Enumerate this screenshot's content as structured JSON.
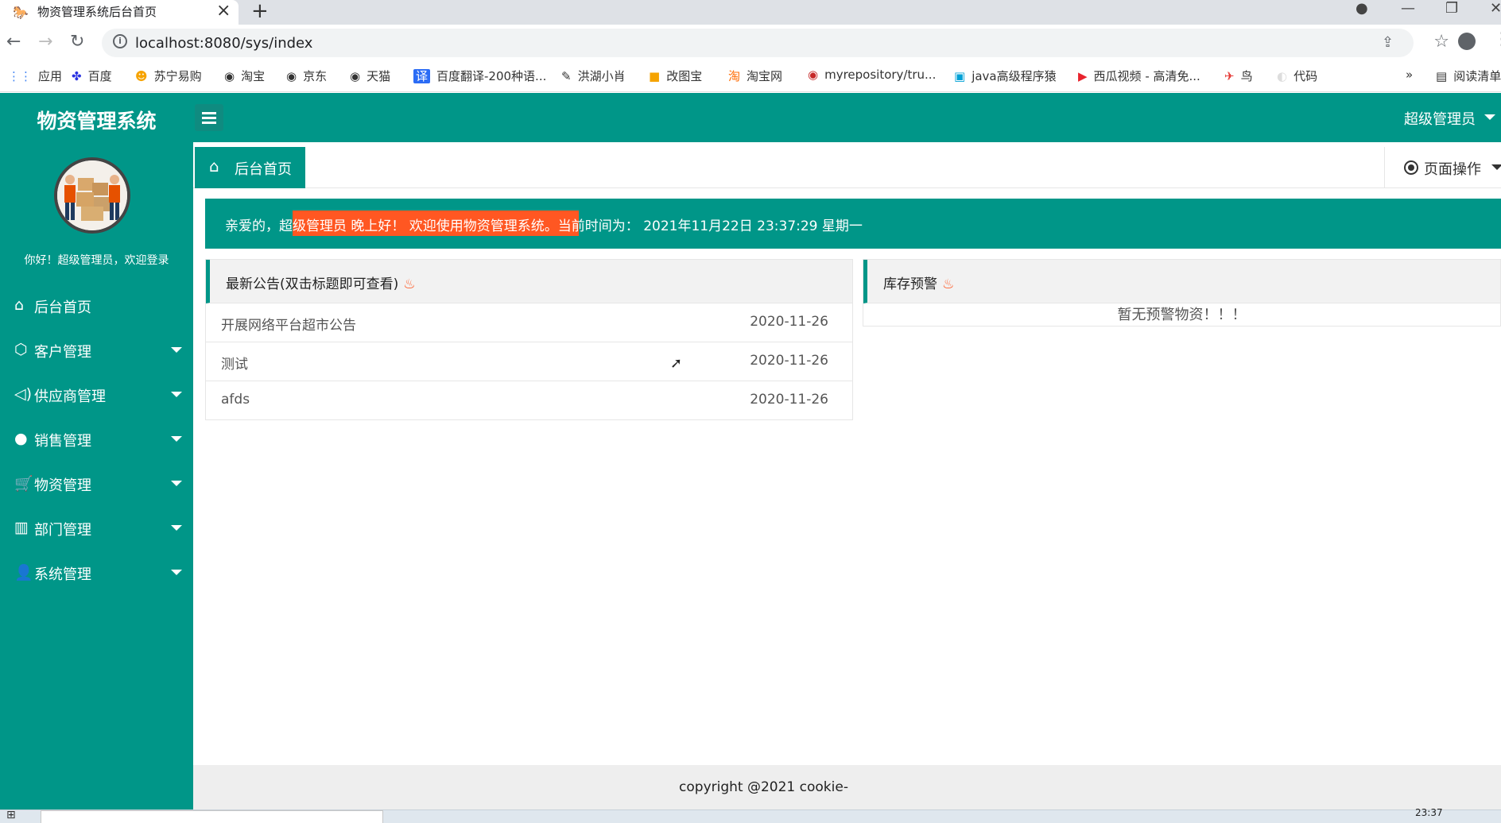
{
  "browser": {
    "tab_title": "物资管理系统后台首页",
    "url": "localhost:8080/sys/index",
    "bookmarks": [
      "应用",
      "百度",
      "苏宁易购",
      "淘宝",
      "京东",
      "天猫",
      "百度翻译-200种语...",
      "洪湖小肖",
      "改图宝",
      "淘宝网",
      "myrepository/tru...",
      "java高级程序猿",
      "西瓜视频 - 高清免...",
      "鸟",
      "代码"
    ],
    "reading_list": "阅读清单"
  },
  "app": {
    "logo": "物资管理系统",
    "greeting": "你好！超级管理员，欢迎登录",
    "user": "超级管理员",
    "menu": [
      {
        "label": "后台首页",
        "icon": "home-icon"
      },
      {
        "label": "客户管理",
        "icon": "cube-icon"
      },
      {
        "label": "供应商管理",
        "icon": "speaker-icon"
      },
      {
        "label": "销售管理",
        "icon": "chat-icon"
      },
      {
        "label": "物资管理",
        "icon": "cart-icon"
      },
      {
        "label": "部门管理",
        "icon": "building-icon"
      },
      {
        "label": "系统管理",
        "icon": "user-icon"
      }
    ],
    "home_tab": "后台首页",
    "page_ops": "页面操作",
    "welcome": "亲爱的，超级管理员 晚上好！  欢迎使用物资管理系统。当前时间为：  2021年11月22日 23:37:29    星期一",
    "notices_title": "最新公告(双击标题即可查看)",
    "notices": [
      {
        "title": "开展网络平台超市公告",
        "date": "2020-11-26"
      },
      {
        "title": "测试",
        "date": "2020-11-26"
      },
      {
        "title": "afds",
        "date": "2020-11-26"
      }
    ],
    "warning_title": "库存预警",
    "warning_empty": "暂无预警物资！！！",
    "footer": "copyright @2021 cookie-"
  },
  "taskbar": {
    "clock": "23:37"
  },
  "colors": {
    "primary": "#009688",
    "accent": "#ff5722"
  }
}
